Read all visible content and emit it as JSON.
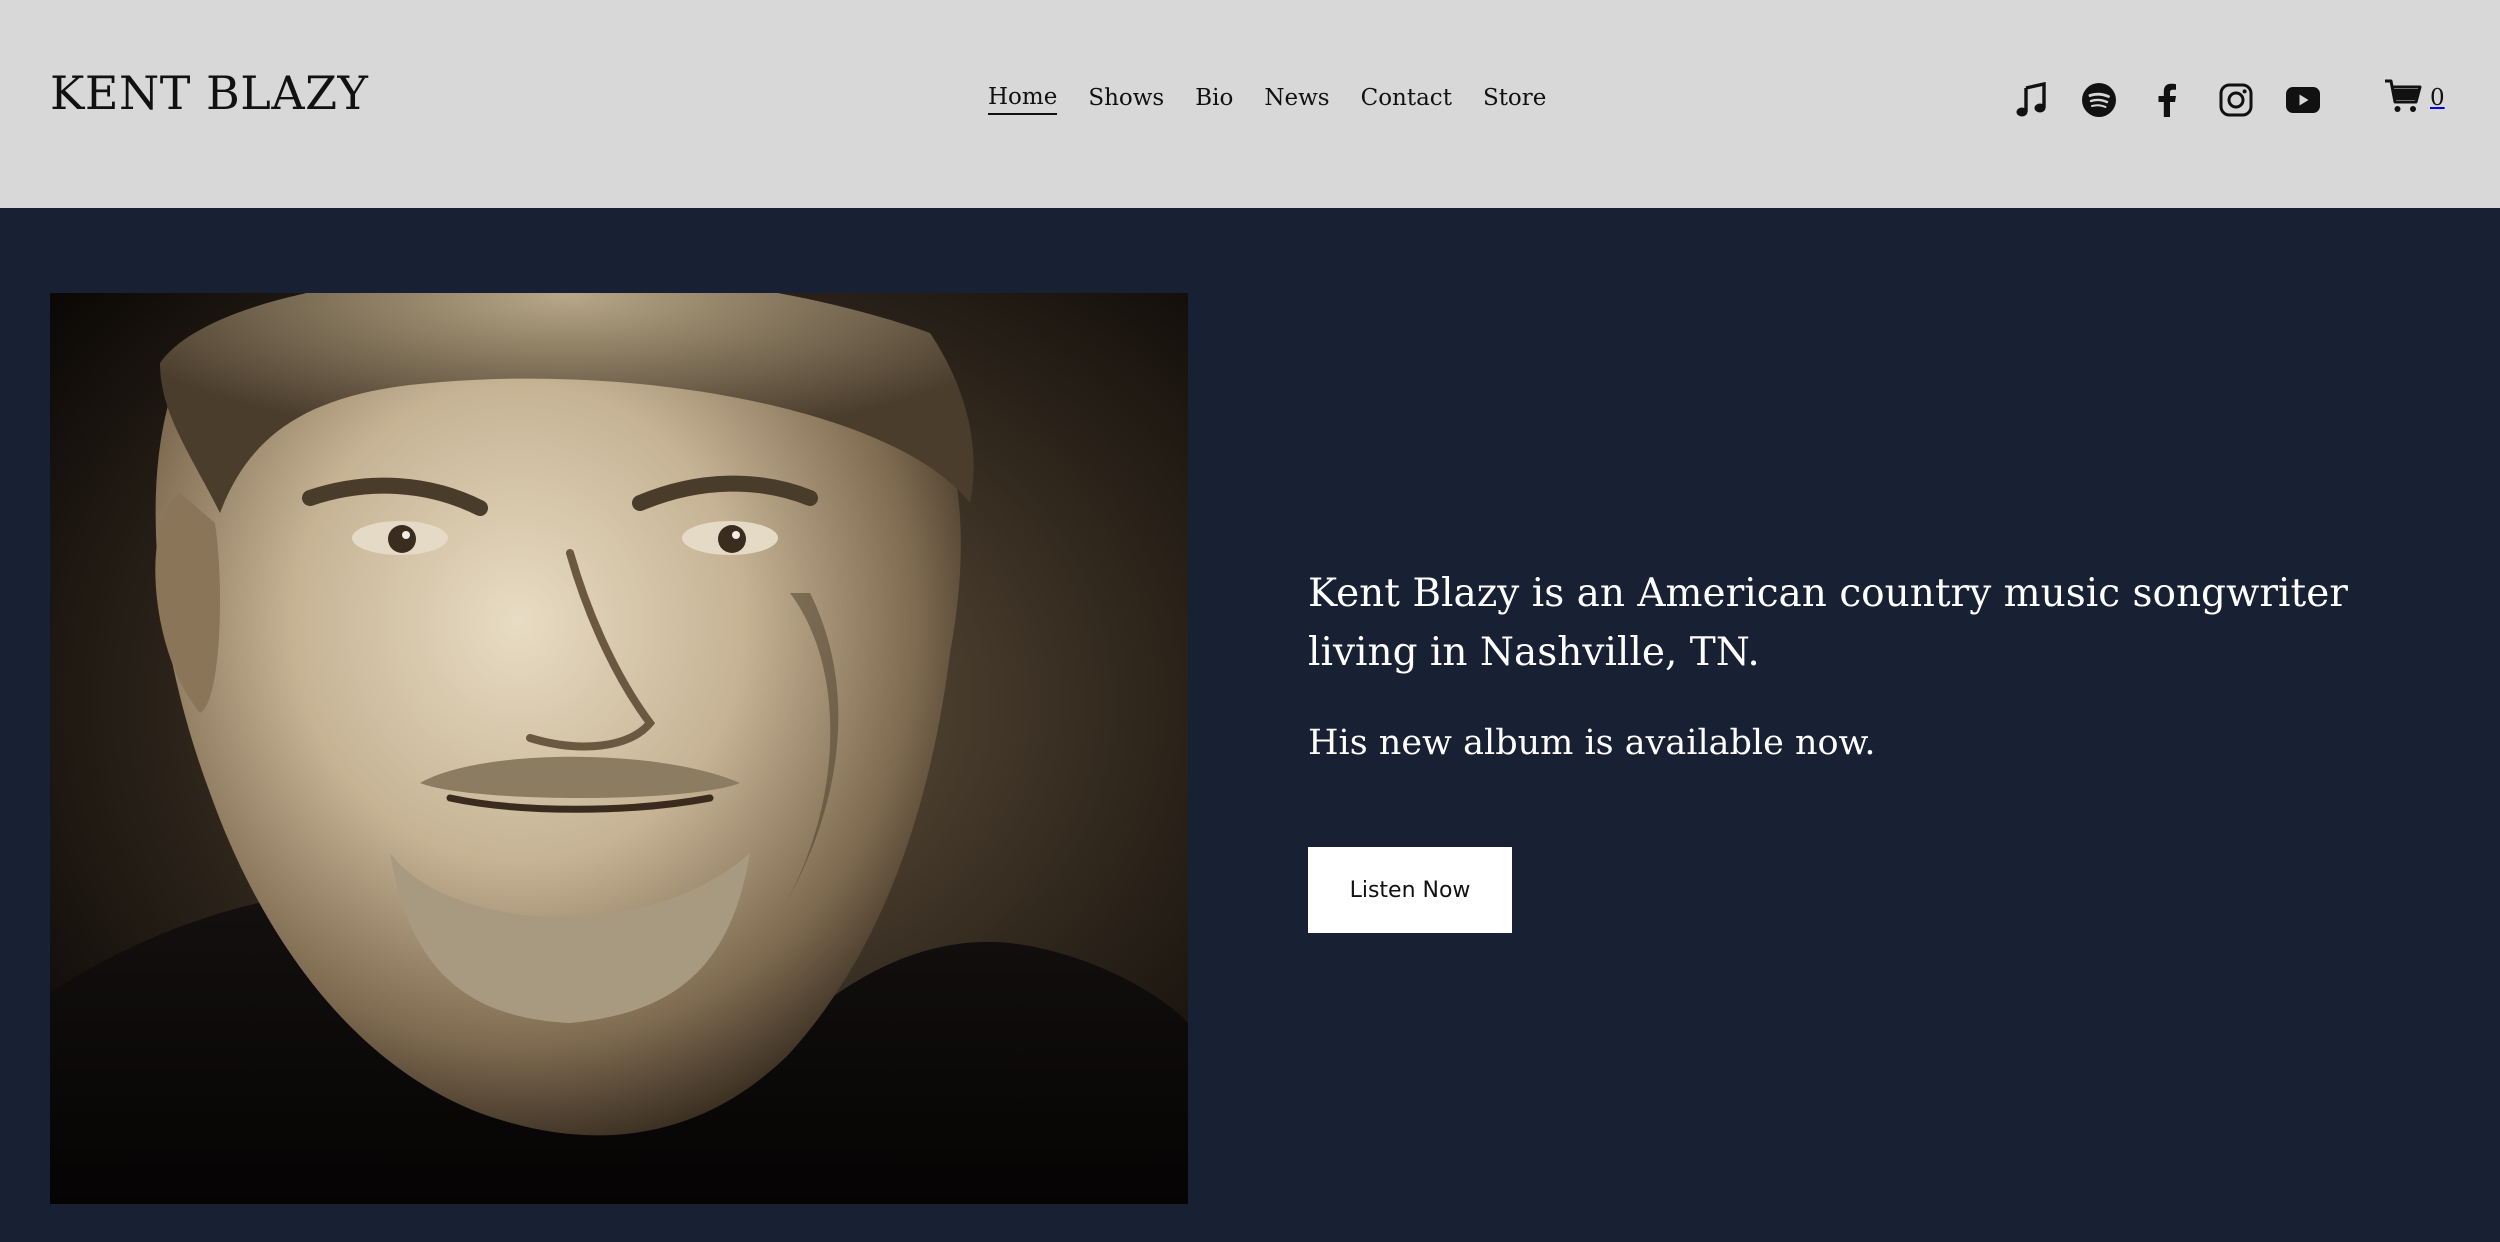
{
  "header": {
    "site_title": "KENT BLAZY",
    "nav": [
      {
        "label": "Home",
        "active": true
      },
      {
        "label": "Shows",
        "active": false
      },
      {
        "label": "Bio",
        "active": false
      },
      {
        "label": "News",
        "active": false
      },
      {
        "label": "Contact",
        "active": false
      },
      {
        "label": "Store",
        "active": false
      }
    ],
    "social_icons": [
      "music-note-icon",
      "spotify-icon",
      "facebook-icon",
      "instagram-icon",
      "youtube-icon"
    ],
    "cart": {
      "icon": "cart-icon",
      "count": "0"
    }
  },
  "hero": {
    "intro": "Kent Blazy is an American country music songwriter living in Nashville, TN.",
    "album_note": "His new album is available now.",
    "cta_label": "Listen Now"
  },
  "colors": {
    "header_bg": "#d8d8d8",
    "hero_bg": "#182033",
    "text_dark": "#111111",
    "text_light": "#ffffff",
    "button_bg": "#ffffff"
  }
}
